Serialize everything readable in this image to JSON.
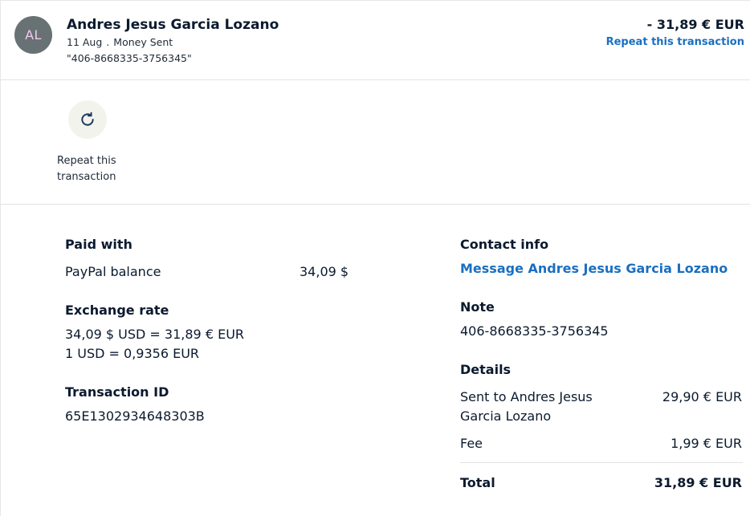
{
  "header": {
    "avatar_initials": "AL",
    "name": "Andres Jesus Garcia Lozano",
    "date": "11 Aug",
    "separator": ".",
    "type": "Money Sent",
    "reference": "\"406-8668335-3756345\"",
    "amount": "- 31,89 € EUR",
    "repeat_link": "Repeat this transaction"
  },
  "actions": {
    "repeat_label": "Repeat this transaction"
  },
  "paid_with": {
    "title": "Paid with",
    "method": "PayPal balance",
    "amount": "34,09 $"
  },
  "exchange_rate": {
    "title": "Exchange rate",
    "line1": "34,09 $ USD = 31,89 € EUR",
    "line2": "1 USD = 0,9356 EUR"
  },
  "transaction_id": {
    "title": "Transaction ID",
    "value": "65E1302934648303B"
  },
  "contact": {
    "title": "Contact info",
    "message_link": "Message Andres Jesus Garcia Lozano"
  },
  "note": {
    "title": "Note",
    "value": "406-8668335-3756345"
  },
  "details": {
    "title": "Details",
    "sent_to_line1": "Sent to Andres Jesus",
    "sent_to_line2": "Garcia Lozano",
    "sent_amount": "29,90 € EUR",
    "fee_label": "Fee",
    "fee_amount": "1,99 € EUR",
    "total_label": "Total",
    "total_amount": "31,89 € EUR"
  }
}
